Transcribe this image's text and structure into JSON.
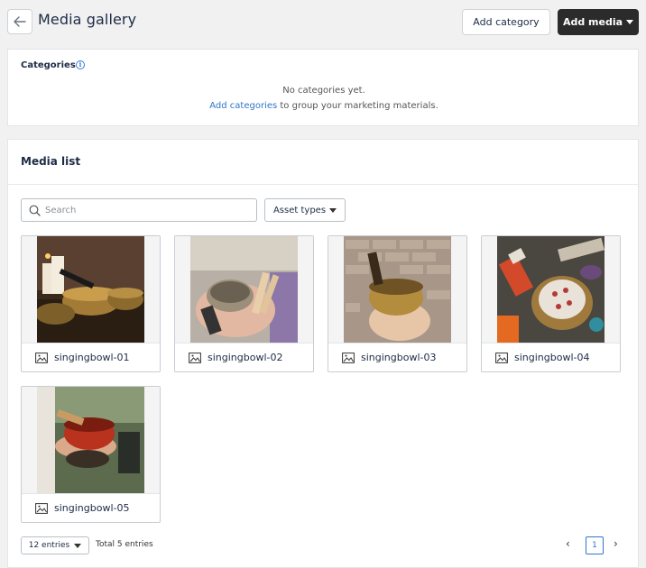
{
  "header": {
    "title": "Media gallery",
    "add_category_label": "Add category",
    "add_media_label": "Add media"
  },
  "categories": {
    "title": "Categories",
    "empty_message": "No categories yet.",
    "add_link": "Add categories",
    "hint_suffix": " to group your marketing materials."
  },
  "media_list": {
    "title": "Media list",
    "search_placeholder": "Search",
    "asset_types_label": "Asset types",
    "items": [
      {
        "name": "singingbowl-01"
      },
      {
        "name": "singingbowl-02"
      },
      {
        "name": "singingbowl-03"
      },
      {
        "name": "singingbowl-04"
      },
      {
        "name": "singingbowl-05"
      }
    ]
  },
  "pagination": {
    "entries_label": "12 entries",
    "total_label": "Total 5 entries",
    "current_page": "1",
    "prev_symbol": "‹",
    "next_symbol": "›"
  },
  "colors": {
    "primary_dark": "#2b2b2b",
    "link_blue": "#2f75c8",
    "page_bg": "#f1f1f2"
  }
}
